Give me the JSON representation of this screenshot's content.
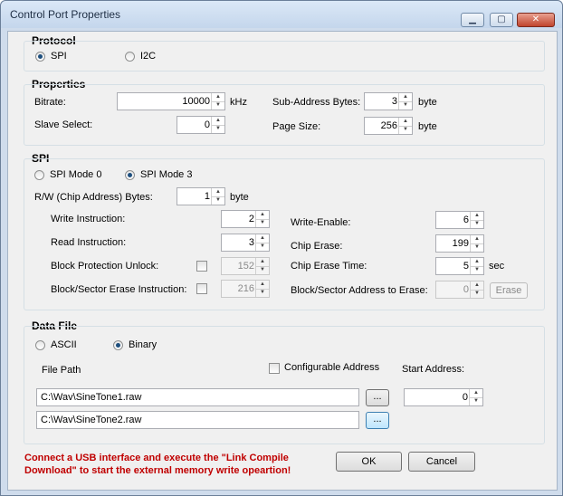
{
  "window": {
    "title": "Control Port Properties",
    "minimize": "▁",
    "maximize": "▢",
    "close": "✕"
  },
  "protocol": {
    "heading": "Protocol",
    "spi": "SPI",
    "i2c": "I2C"
  },
  "properties": {
    "heading": "Properties",
    "bitrate_label": "Bitrate:",
    "bitrate_value": "10000",
    "bitrate_unit": "kHz",
    "slave_select_label": "Slave Select:",
    "slave_select_value": "0",
    "sub_address_label": "Sub-Address Bytes:",
    "sub_address_value": "3",
    "sub_address_unit": "byte",
    "page_size_label": "Page Size:",
    "page_size_value": "256",
    "page_size_unit": "byte"
  },
  "spi": {
    "heading": "SPI",
    "mode0": "SPI Mode 0",
    "mode3": "SPI Mode 3",
    "rw_label": "R/W (Chip Address) Bytes:",
    "rw_value": "1",
    "rw_unit": "byte",
    "write_instr_label": "Write Instruction:",
    "write_instr_value": "2",
    "read_instr_label": "Read Instruction:",
    "read_instr_value": "3",
    "block_prot_label": "Block Protection Unlock:",
    "block_prot_value": "152",
    "block_erase_label": "Block/Sector Erase Instruction:",
    "block_erase_value": "216",
    "write_enable_label": "Write-Enable:",
    "write_enable_value": "6",
    "chip_erase_label": "Chip Erase:",
    "chip_erase_value": "199",
    "chip_erase_time_label": "Chip Erase Time:",
    "chip_erase_time_value": "5",
    "chip_erase_time_unit": "sec",
    "block_addr_label": "Block/Sector Address to Erase:",
    "block_addr_value": "0",
    "erase_button": "Erase"
  },
  "datafile": {
    "heading": "Data File",
    "ascii": "ASCII",
    "binary": "Binary",
    "file_path_label": "File Path",
    "configurable_label": "Configurable Address",
    "start_address_label": "Start Address:",
    "path1": "C:\\Wav\\SineTone1.raw",
    "path2": "C:\\Wav\\SineTone2.raw",
    "browse": "...",
    "start_address_value": "0"
  },
  "footer": {
    "warning_line1": "Connect a USB interface and execute the \"Link Compile",
    "warning_line2": "Download\" to start the external memory write opeartion!",
    "ok": "OK",
    "cancel": "Cancel"
  }
}
